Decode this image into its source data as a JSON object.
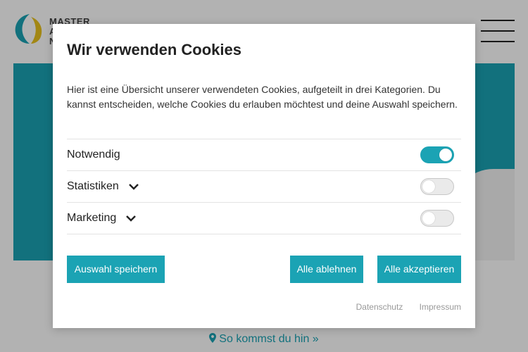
{
  "site": {
    "logo_lines": [
      "MASTER",
      "A",
      "N"
    ],
    "directions_link": "So kommst du hin »"
  },
  "modal": {
    "title": "Wir verwenden Cookies",
    "description": "Hier ist eine Übersicht unserer verwendeten Cookies, aufgeteilt in drei Kategorien. Du kannst entscheiden, welche Cookies du erlauben möchtest und deine Auswahl speichern.",
    "categories": [
      {
        "label": "Notwendig",
        "enabled": true,
        "expandable": false
      },
      {
        "label": "Statistiken",
        "enabled": false,
        "expandable": true
      },
      {
        "label": "Marketing",
        "enabled": false,
        "expandable": true
      }
    ],
    "buttons": {
      "save": "Auswahl speichern",
      "reject": "Alle ablehnen",
      "accept": "Alle akzeptieren"
    },
    "links": {
      "privacy": "Datenschutz",
      "imprint": "Impressum"
    }
  },
  "colors": {
    "accent": "#1ba3b4",
    "overlay": "rgba(0,0,0,0.3)"
  },
  "icons": [
    "logo-mark-icon",
    "hamburger-menu-icon",
    "chevron-down-icon",
    "map-pin-icon"
  ]
}
